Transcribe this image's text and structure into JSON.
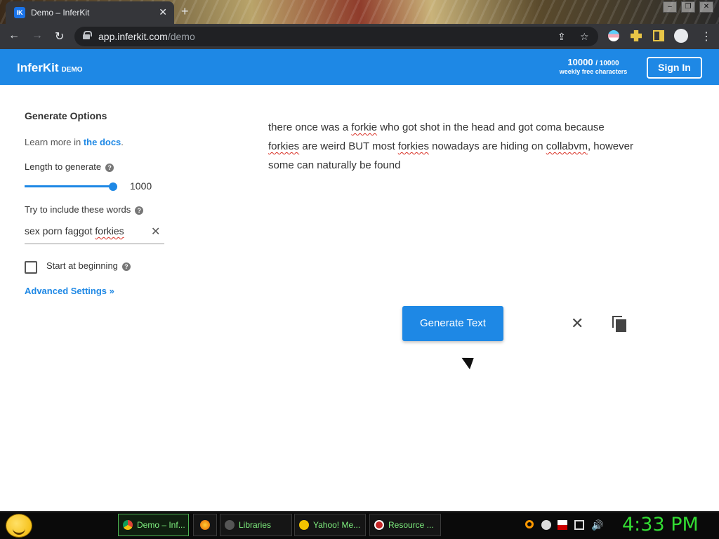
{
  "browser": {
    "tab_title": "Demo – InferKit",
    "favicon_text": "IK",
    "url_host": "app.inferkit.com",
    "url_path": "/demo"
  },
  "header": {
    "brand": "InferKit",
    "brand_tag": "DEMO",
    "quota_used": "10000",
    "quota_total": "/ 10000",
    "quota_label": "weekly free characters",
    "signin_label": "Sign In"
  },
  "options": {
    "title": "Generate Options",
    "learn_prefix": "Learn more in ",
    "learn_link": "the docs",
    "learn_suffix": ".",
    "length_label": "Length to generate",
    "length_value": "1000",
    "words_label": "Try to include these words",
    "words_value": "sex porn faggot forkies",
    "start_label": "Start at beginning",
    "start_checked": false,
    "advanced_label": "Advanced Settings »"
  },
  "output": {
    "t1": "there once was a ",
    "w1": "forkie",
    "t2": " who got shot in the head and got coma because ",
    "w2": "forkies",
    "t3": " are weird BUT most ",
    "w3": "forkies",
    "t4": " nowadays are hiding on ",
    "w4": "collabvm",
    "t5": ", however some can naturally be found"
  },
  "actions": {
    "generate_label": "Generate Text"
  },
  "taskbar": {
    "tasks": [
      {
        "label": "Demo – Inf..."
      },
      {
        "label": "Libraries"
      },
      {
        "label": "Yahoo! Me..."
      },
      {
        "label": "Resource ..."
      }
    ],
    "clock": "4:33 PM"
  },
  "colors": {
    "accent": "#1e88e5",
    "clock": "#33dd33"
  }
}
